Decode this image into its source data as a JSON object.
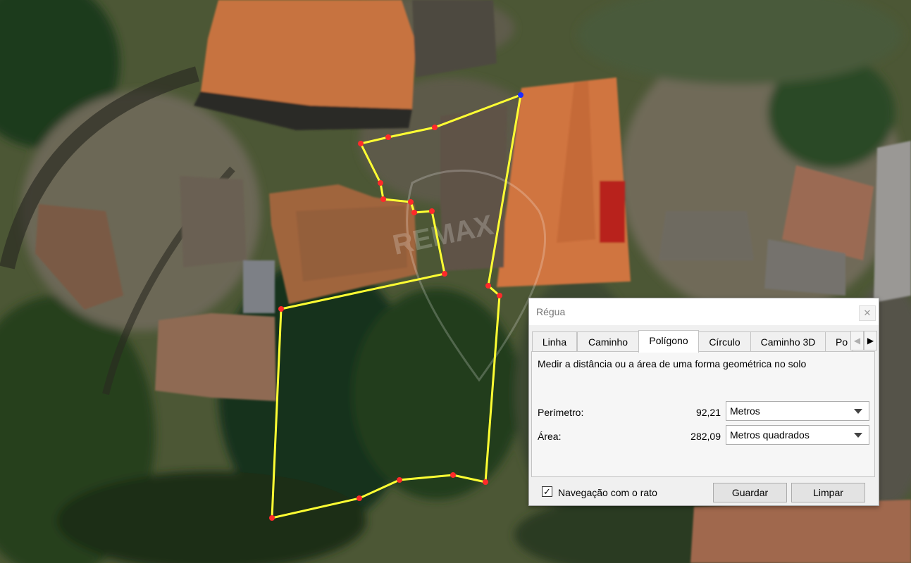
{
  "map": {
    "watermark": "REMAX",
    "colors": {
      "polygon_line": "#ffff33",
      "vertex": "#ff2a2a",
      "start_vertex": "#1c2cff"
    }
  },
  "dialog": {
    "title": "Régua",
    "close_icon": "close-icon",
    "tabs": [
      "Linha",
      "Caminho",
      "Polígono",
      "Círculo",
      "Caminho 3D",
      "Po"
    ],
    "active_tab": "Polígono",
    "description": "Medir a distância ou a área de uma forma geométrica no solo",
    "perimeter": {
      "label": "Perímetro:",
      "value": "92,21",
      "unit": "Metros"
    },
    "area": {
      "label": "Área:",
      "value": "282,09",
      "unit": "Metros quadrados"
    },
    "mouse_navigation": {
      "label": "Navegação com o rato",
      "checked": true
    },
    "save_label": "Guardar",
    "clear_label": "Limpar"
  }
}
